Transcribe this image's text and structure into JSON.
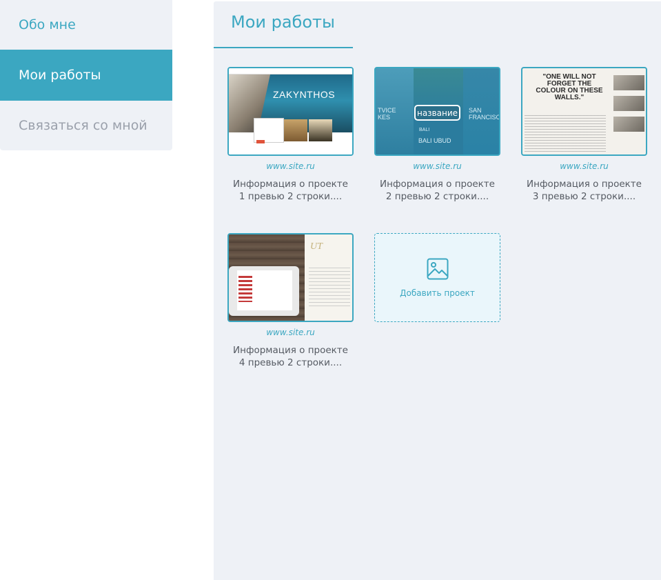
{
  "sidebar": {
    "items": [
      {
        "label": "Обо мне"
      },
      {
        "label": "Мои работы"
      },
      {
        "label": "Связаться со мной"
      }
    ]
  },
  "main": {
    "title": "Мои работы",
    "projects": [
      {
        "link": "www.site.ru",
        "desc_line1": "Информация о проекте",
        "desc_line2": "1 превью 2 строки....",
        "thumb_text": "ZAKYNTHOS"
      },
      {
        "link": "www.site.ru",
        "desc_line1": "Информация о проекте",
        "desc_line2": "2 превью 2 строки....",
        "overlay_label": "название",
        "thumb_texts": [
          "TVICE",
          "KES",
          "BALI",
          "BALI UBUD",
          "SAN FRANCISCO"
        ]
      },
      {
        "link": "www.site.ru",
        "desc_line1": "Информация о проекте",
        "desc_line2": "3 превью 2 строки....",
        "quote": "\"ONE WILL NOT FORGET THE COLOUR ON THESE WALLS.\""
      },
      {
        "link": "www.site.ru",
        "desc_line1": "Информация о проекте",
        "desc_line2": "4 превью 2 строки....",
        "thumb_text": "UT"
      }
    ],
    "add_project": {
      "label": "Добавить проект",
      "icon": "image-icon"
    }
  },
  "colors": {
    "accent": "#3ba7c1",
    "panel_bg": "#eef1f6",
    "text": "#555a62",
    "muted": "#9aa0ab"
  }
}
